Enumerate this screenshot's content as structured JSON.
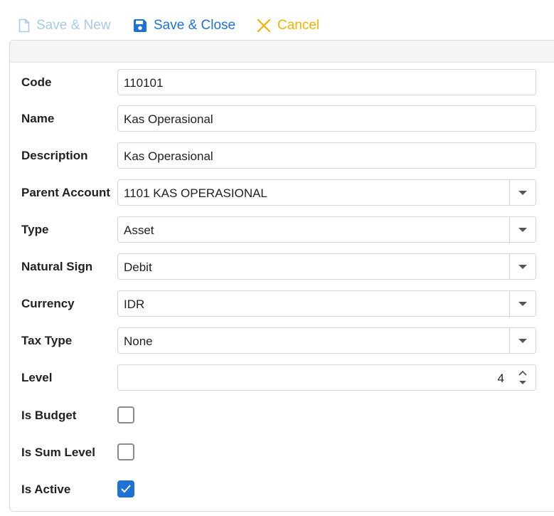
{
  "toolbar": {
    "save_new_label": "Save & New",
    "save_close_label": "Save & Close",
    "cancel_label": "Cancel"
  },
  "form": {
    "code": {
      "label": "Code",
      "value": "110101"
    },
    "name": {
      "label": "Name",
      "value": "Kas Operasional"
    },
    "description": {
      "label": "Description",
      "value": "Kas Operasional"
    },
    "parent_account": {
      "label": "Parent Account",
      "value": "1101 KAS OPERASIONAL"
    },
    "type": {
      "label": "Type",
      "value": "Asset"
    },
    "natural_sign": {
      "label": "Natural Sign",
      "value": "Debit"
    },
    "currency": {
      "label": "Currency",
      "value": "IDR"
    },
    "tax_type": {
      "label": "Tax Type",
      "value": "None"
    },
    "level": {
      "label": "Level",
      "value": "4"
    },
    "is_budget": {
      "label": "Is Budget",
      "checked": false
    },
    "is_sum_level": {
      "label": "Is Sum Level",
      "checked": false
    },
    "is_active": {
      "label": "Is Active",
      "checked": true
    }
  },
  "colors": {
    "accent": "#1e72d6",
    "disabled": "#a9c9ec",
    "cancel": "#f0b400"
  },
  "icons": {
    "save_new": "file-icon",
    "save_close": "floppy-disk-icon",
    "cancel": "close-icon",
    "dropdown": "chevron-down-icon",
    "spin_up": "caret-up-icon",
    "spin_down": "caret-down-icon",
    "checkmark": "check-icon"
  }
}
